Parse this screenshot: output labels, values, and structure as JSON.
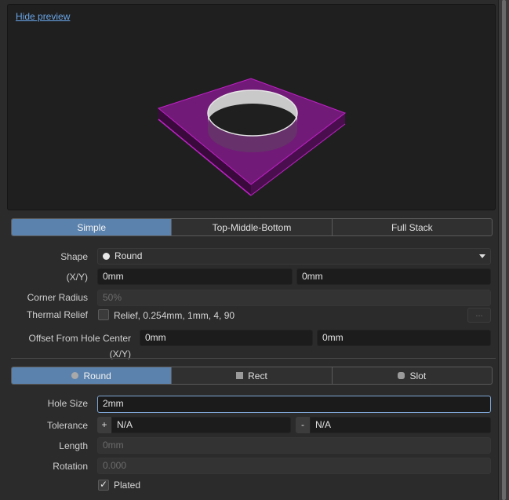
{
  "preview": {
    "hide_label": "Hide preview"
  },
  "stack_tabs": [
    {
      "label": "Simple",
      "active": true
    },
    {
      "label": "Top-Middle-Bottom",
      "active": false
    },
    {
      "label": "Full Stack",
      "active": false
    }
  ],
  "shape": {
    "label": "Shape",
    "value": "Round"
  },
  "xy": {
    "label": "(X/Y)",
    "x": "0mm",
    "y": "0mm"
  },
  "corner_radius": {
    "label": "Corner Radius",
    "value": "50%"
  },
  "thermal_relief": {
    "label": "Thermal Relief",
    "checked": false,
    "text": "Relief, 0.254mm, 1mm, 4, 90",
    "button": "..."
  },
  "offset": {
    "label": "Offset From Hole Center (X/Y)",
    "x": "0mm",
    "y": "0mm"
  },
  "hole_tabs": [
    {
      "label": "Round",
      "icon": "circle-icon",
      "active": true
    },
    {
      "label": "Rect",
      "icon": "square-icon",
      "active": false
    },
    {
      "label": "Slot",
      "icon": "rounded-square-icon",
      "active": false
    }
  ],
  "hole_size": {
    "label": "Hole Size",
    "value": "2mm"
  },
  "tolerance": {
    "label": "Tolerance",
    "plus": "+",
    "plus_value": "N/A",
    "minus": "-",
    "minus_value": "N/A"
  },
  "length": {
    "label": "Length",
    "value": "0mm"
  },
  "rotation": {
    "label": "Rotation",
    "value": "0.000"
  },
  "plated": {
    "label": "Plated",
    "checked": true
  },
  "colors": {
    "accent": "#5b82ad",
    "pad": "#8a1c8f",
    "link": "#6aa6e8"
  }
}
